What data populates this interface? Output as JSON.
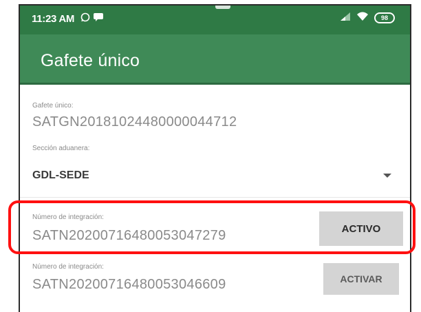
{
  "status_bar": {
    "time": "11:23 AM",
    "notification_icons": [
      "whatsapp-icon",
      "chat-icon"
    ],
    "signal_icon": "signal-icon",
    "wifi_icon": "wifi-icon",
    "battery": "98"
  },
  "app_bar": {
    "title": "Gafete único"
  },
  "badge": {
    "label": "Gafete único:",
    "value": "SATGN20181024480000044712"
  },
  "customs_section": {
    "label": "Sección aduanera:",
    "selected": "GDL-SEDE"
  },
  "integrations": [
    {
      "label": "Número de integración:",
      "value": "SATN20200716480053047279",
      "button_label": "ACTIVO"
    },
    {
      "label": "Número de integración:",
      "value": "SATN20200716480053046609",
      "button_label": "ACTIVAR"
    }
  ],
  "colors": {
    "status_bar": "#2f7a45",
    "app_bar": "#3f8a57",
    "highlight": "#ff1010",
    "button": "#d4d4d4"
  }
}
